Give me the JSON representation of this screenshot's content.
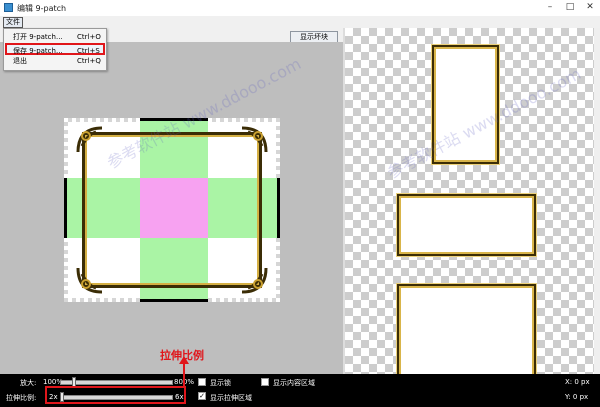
{
  "window": {
    "title": "编辑 9-patch"
  },
  "menubar": {
    "file": "文件"
  },
  "file_menu": {
    "items": [
      {
        "label": "打开 9-patch...",
        "shortcut": "Ctrl+O"
      },
      {
        "label": "保存 9-patch...",
        "shortcut": "Ctrl+S"
      },
      {
        "label": "退出",
        "shortcut": "Ctrl+Q"
      }
    ]
  },
  "toolbar": {
    "show_bad_patches": "显示坏块"
  },
  "bottom": {
    "zoom_label": "放大:",
    "zoom_min": "100%",
    "zoom_max": "800%",
    "scale_label": "拉伸比例:",
    "scale_min": "2x",
    "scale_max": "6x",
    "show_lock": "显示锁",
    "show_content": "显示内容区域",
    "show_stretch": "显示拉伸区域",
    "x_readout": "X: 0 px",
    "y_readout": "Y: 0 px"
  },
  "annotation": "拉伸比例",
  "watermark": "参考软件站 www.ddooo.com",
  "colors": {
    "stretch_green": "#a5f3a0",
    "overlap_pink": "#f7a2f1",
    "highlight_red": "#e0161b"
  }
}
